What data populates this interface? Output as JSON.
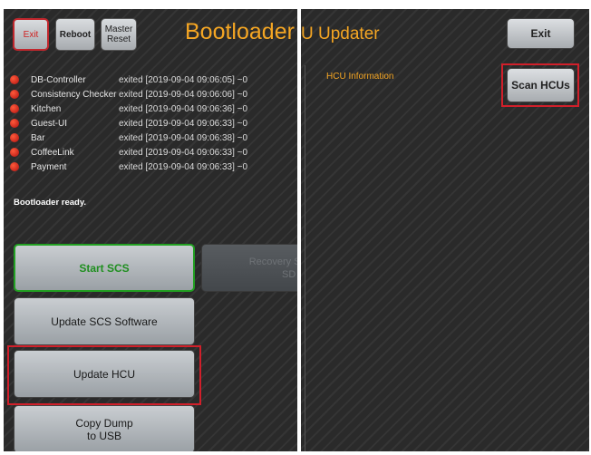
{
  "left_panel": {
    "header": {
      "exit_label": "Exit",
      "reboot_label": "Reboot",
      "master_reset_line1": "Master",
      "master_reset_line2": "Reset",
      "title": "Bootloader"
    },
    "processes": [
      {
        "name": "DB-Controller",
        "status": "exited [2019-09-04 09:06:05] ~0"
      },
      {
        "name": "Consistency Checker",
        "status": "exited [2019-09-04 09:06:06] ~0"
      },
      {
        "name": "Kitchen",
        "status": "exited [2019-09-04 09:06:36] ~0"
      },
      {
        "name": "Guest-UI",
        "status": "exited [2019-09-04 09:06:33] ~0"
      },
      {
        "name": "Bar",
        "status": "exited [2019-09-04 09:06:38] ~0"
      },
      {
        "name": "CoffeeLink",
        "status": "exited [2019-09-04 09:06:33] ~0"
      },
      {
        "name": "Payment",
        "status": "exited [2019-09-04 09:06:33] ~0"
      }
    ],
    "status_text": "Bootloader ready.",
    "buttons": {
      "start_scs": "Start SCS",
      "recovery_line1": "Recovery S",
      "recovery_line2": "SD C",
      "update_scs": "Update SCS Software",
      "update_hcu": "Update HCU",
      "copy_dump_line1": "Copy Dump",
      "copy_dump_line2": "to USB"
    }
  },
  "right_panel": {
    "title": "U Updater",
    "exit_label": "Exit",
    "hcu_info_label": "HCU Information",
    "scan_label": "Scan HCUs"
  },
  "colors": {
    "accent": "#f5a623",
    "highlight": "#d11f2a",
    "status_dot": "#d82020",
    "start_green": "#22a022"
  }
}
